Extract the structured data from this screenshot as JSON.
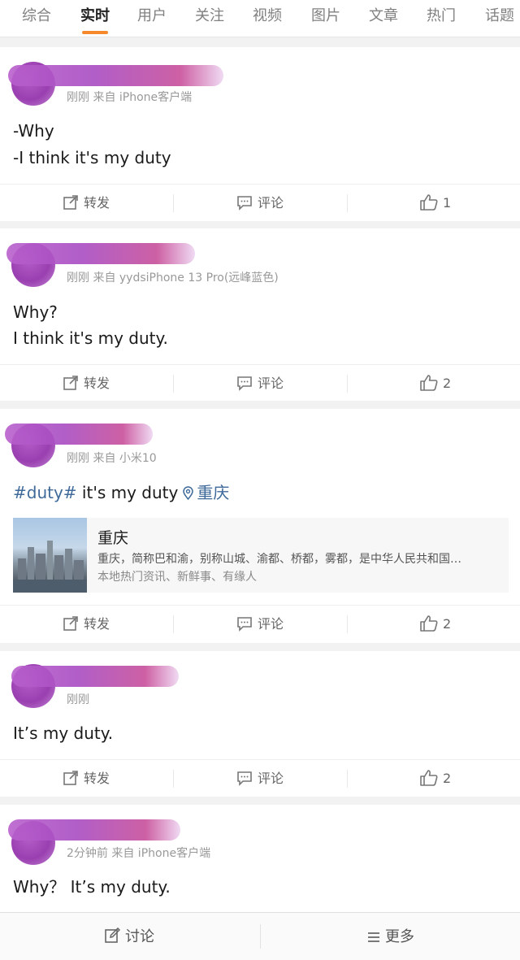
{
  "tabs": [
    "综合",
    "实时",
    "用户",
    "关注",
    "视频",
    "图片",
    "文章",
    "热门",
    "话题"
  ],
  "active_tab": 1,
  "colors": {
    "accent": "#f5892b",
    "link": "#3f6a9a"
  },
  "actions": {
    "repost": "转发",
    "comment": "评论"
  },
  "posts": [
    {
      "meta": "刚刚 来自 iPhone客户端",
      "lines": [
        "-Why",
        "-I think it's my duty"
      ],
      "likes": "1"
    },
    {
      "meta": "刚刚 来自 yydsiPhone 13 Pro(远峰蓝色)",
      "lines": [
        "Why?",
        "I think it's my duty."
      ],
      "likes": "2"
    },
    {
      "meta": "刚刚 来自 小米10",
      "topic": "#duty#",
      "text": " it's my duty",
      "location": "重庆",
      "likes": "2",
      "place": {
        "title": "重庆",
        "desc": "重庆，简称巴和渝，别称山城、渝都、桥都，雾都，是中华人民共和国…",
        "sub": "本地热门资讯、新鲜事、有缘人"
      }
    },
    {
      "meta": "刚刚",
      "lines": [
        "It’s my duty."
      ],
      "likes": "2"
    },
    {
      "meta": "2分钟前 来自 iPhone客户端",
      "lines": [
        "Why？ It’s my duty."
      ]
    }
  ],
  "bottom": {
    "discuss": "讨论",
    "more": "更多"
  },
  "icons": {
    "repost": "repost-icon",
    "comment": "comment-icon",
    "like": "thumbs-up-icon",
    "location": "location-pin-icon",
    "edit": "edit-icon",
    "menu": "menu-icon"
  }
}
